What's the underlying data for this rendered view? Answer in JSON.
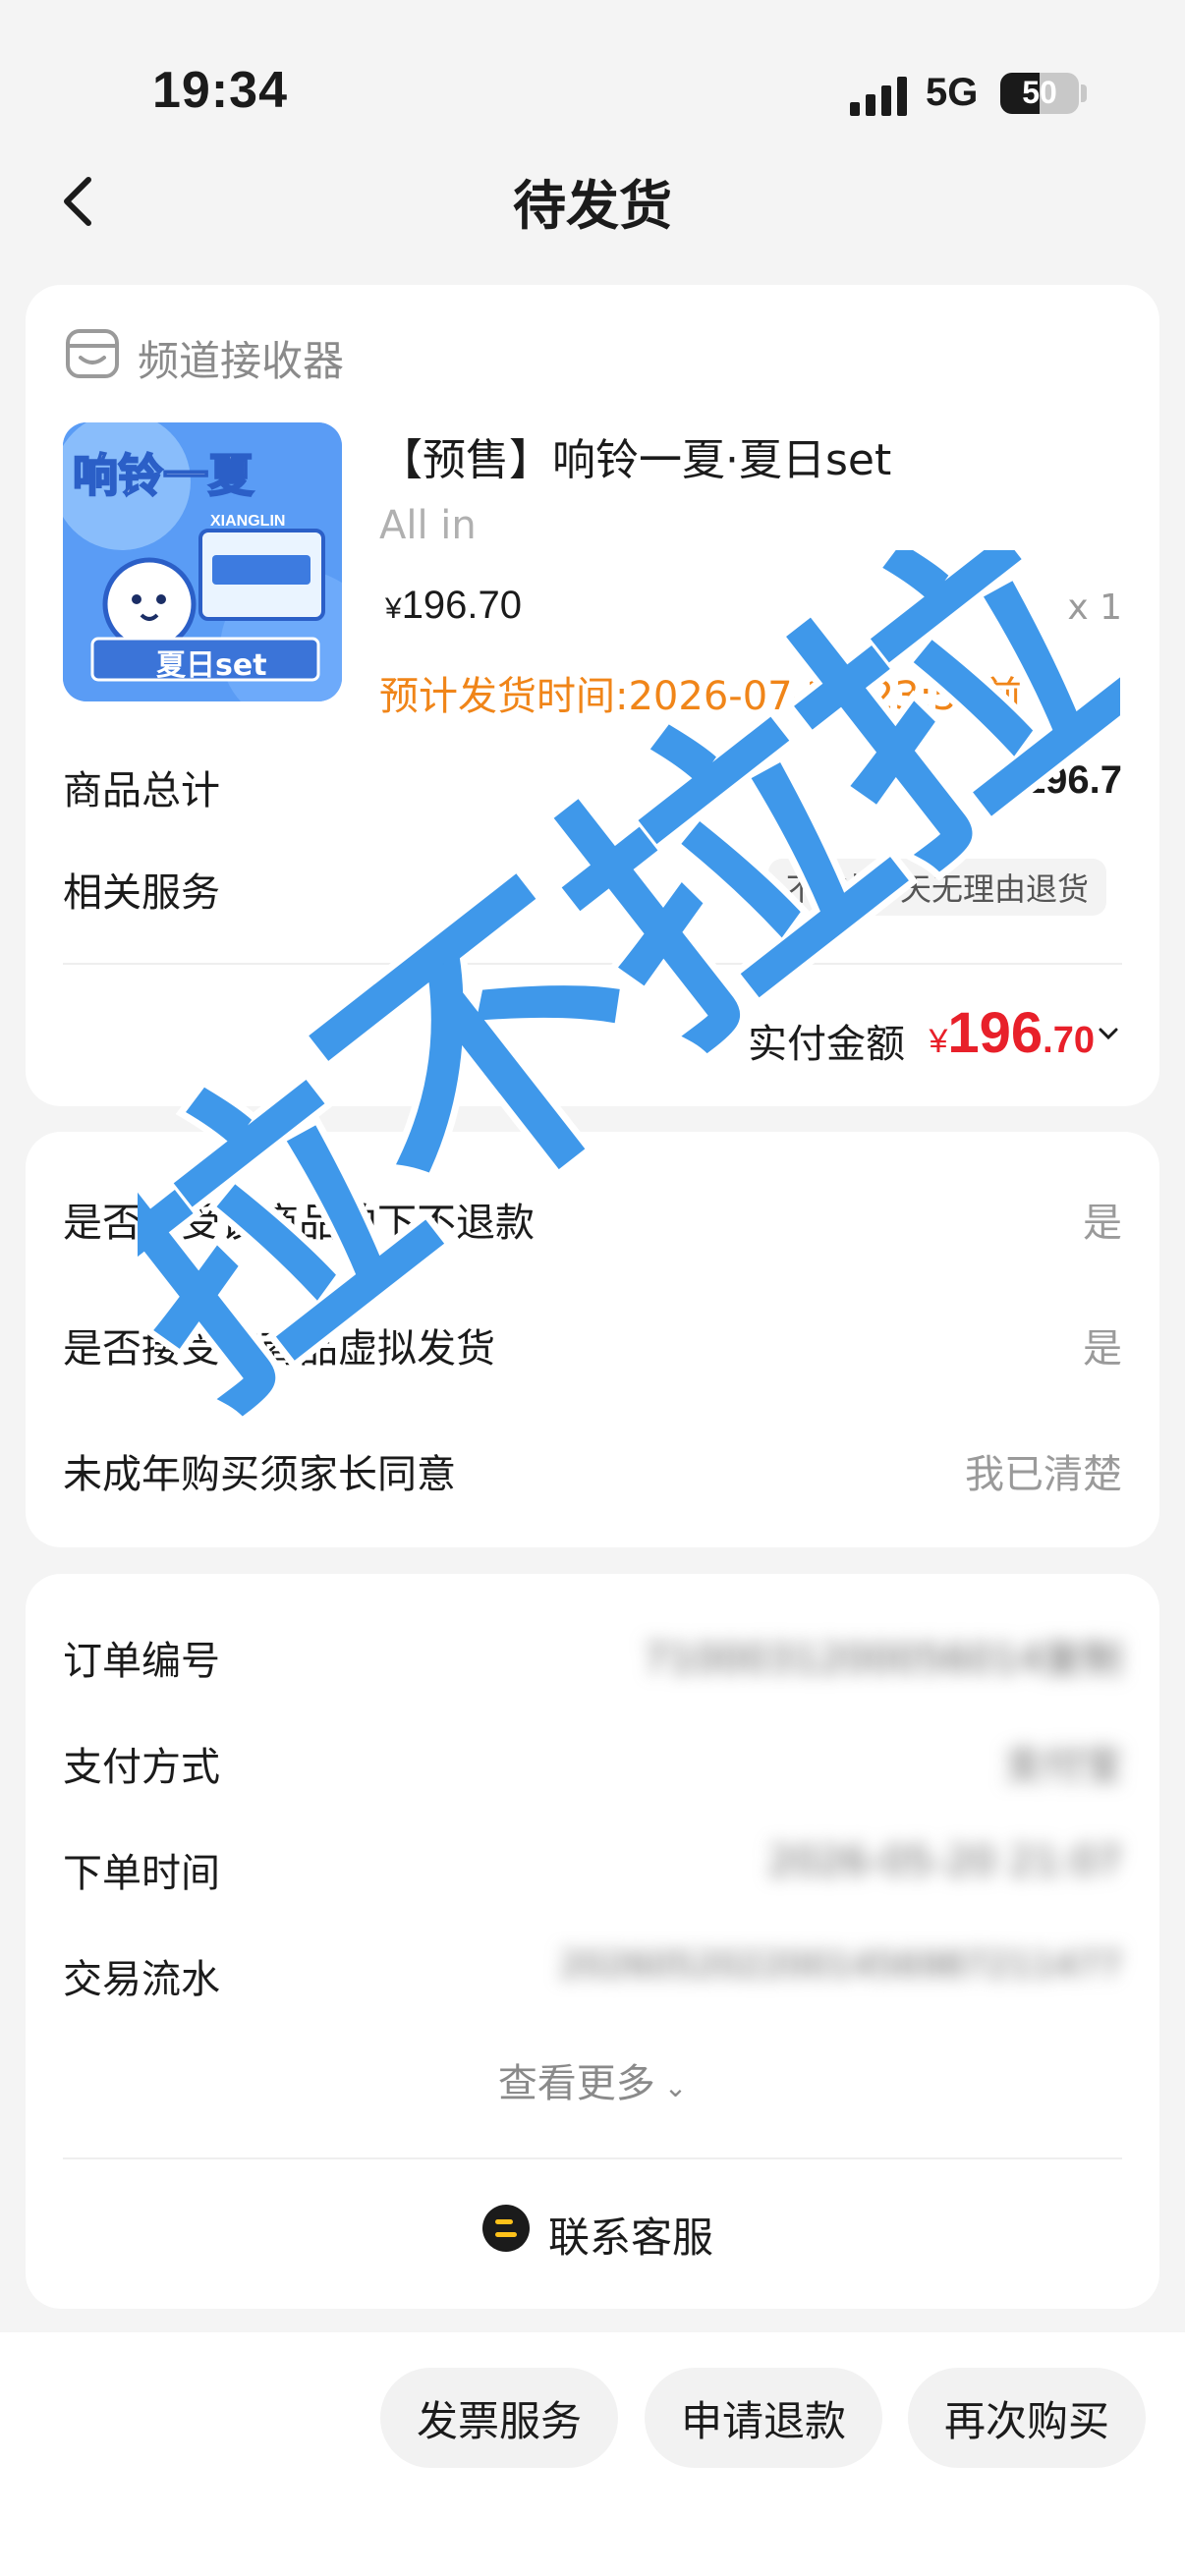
{
  "status_bar": {
    "time": "19:34",
    "network": "5G",
    "battery": "50",
    "battery_level": 0.5
  },
  "nav": {
    "title": "待发货"
  },
  "shop": {
    "name": "频道接收器"
  },
  "product": {
    "title": "【预售】响铃一夏·夏日set",
    "spec": "All in",
    "price_symbol": "¥",
    "price": "196.70",
    "qty": "x 1",
    "ship_time": "预计发货时间:2026-07-28 23:59前",
    "thumb_text_top": "响铃一夏",
    "thumb_text_bottom": "夏日set",
    "thumb_label": "XIANGLIN"
  },
  "summary": {
    "total_label": "商品总计",
    "total_value": "¥196.7",
    "service_label": "相关服务",
    "service_badge": "不支持7天无理由退货",
    "paid_label": "实付金额",
    "paid_symbol": "¥",
    "paid_int": "196",
    "paid_dec": ".70"
  },
  "agreements": [
    {
      "label": "是否接受该商品拍下不退款",
      "value": "是"
    },
    {
      "label": "是否接受该商品虚拟发货",
      "value": "是"
    },
    {
      "label": "未成年购买须家长同意",
      "value": "我已清楚"
    }
  ],
  "order_info": {
    "rows": [
      {
        "label": "订单编号",
        "value": "7100031200056014复制"
      },
      {
        "label": "支付方式",
        "value": "支付宝"
      },
      {
        "label": "下单时间",
        "value": "2026-05-20 21:07"
      },
      {
        "label": "交易流水",
        "value": "2026052022001456987211477"
      }
    ],
    "more": "查看更多",
    "customer_service": "联系客服"
  },
  "actions": [
    "发票服务",
    "申请退款",
    "再次购买"
  ],
  "watermark": "拉不拉拉",
  "colors": {
    "accent_orange": "#f08519",
    "price_red": "#e8202a",
    "watermark_blue": "#2f8fe8"
  }
}
